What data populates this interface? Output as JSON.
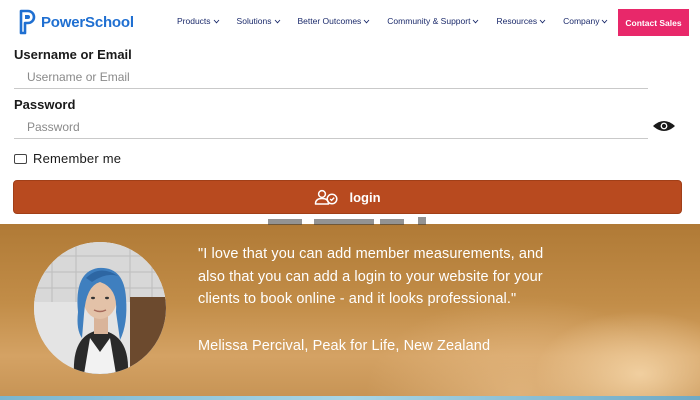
{
  "navbar": {
    "logo_text": "PowerSchool",
    "items": [
      {
        "label": "Products"
      },
      {
        "label": "Solutions"
      },
      {
        "label": "Better Outcomes"
      },
      {
        "label": "Community & Support"
      },
      {
        "label": "Resources"
      },
      {
        "label": "Company"
      }
    ],
    "contact_label": "Contact Sales",
    "brand_color": "#1f6fd1",
    "contact_color": "#e8286a"
  },
  "login_form": {
    "username_label": "Username or Email",
    "username_placeholder": "Username or Email",
    "username_value": "",
    "password_label": "Password",
    "password_placeholder": "Password",
    "password_value": "",
    "remember_label": "Remember me",
    "remember_checked": false,
    "login_label": "login",
    "login_color": "#b84a1f",
    "icons": {
      "password_toggle": "eye-icon",
      "login": "users-icon"
    }
  },
  "testimonial": {
    "quote_lines": [
      "\"I love that you can add member measurements, and",
      "also that you can add a login to your website for your",
      "clients to book online - and it looks professional.\""
    ],
    "author": "Melissa Percival, Peak for Life, New Zealand"
  }
}
